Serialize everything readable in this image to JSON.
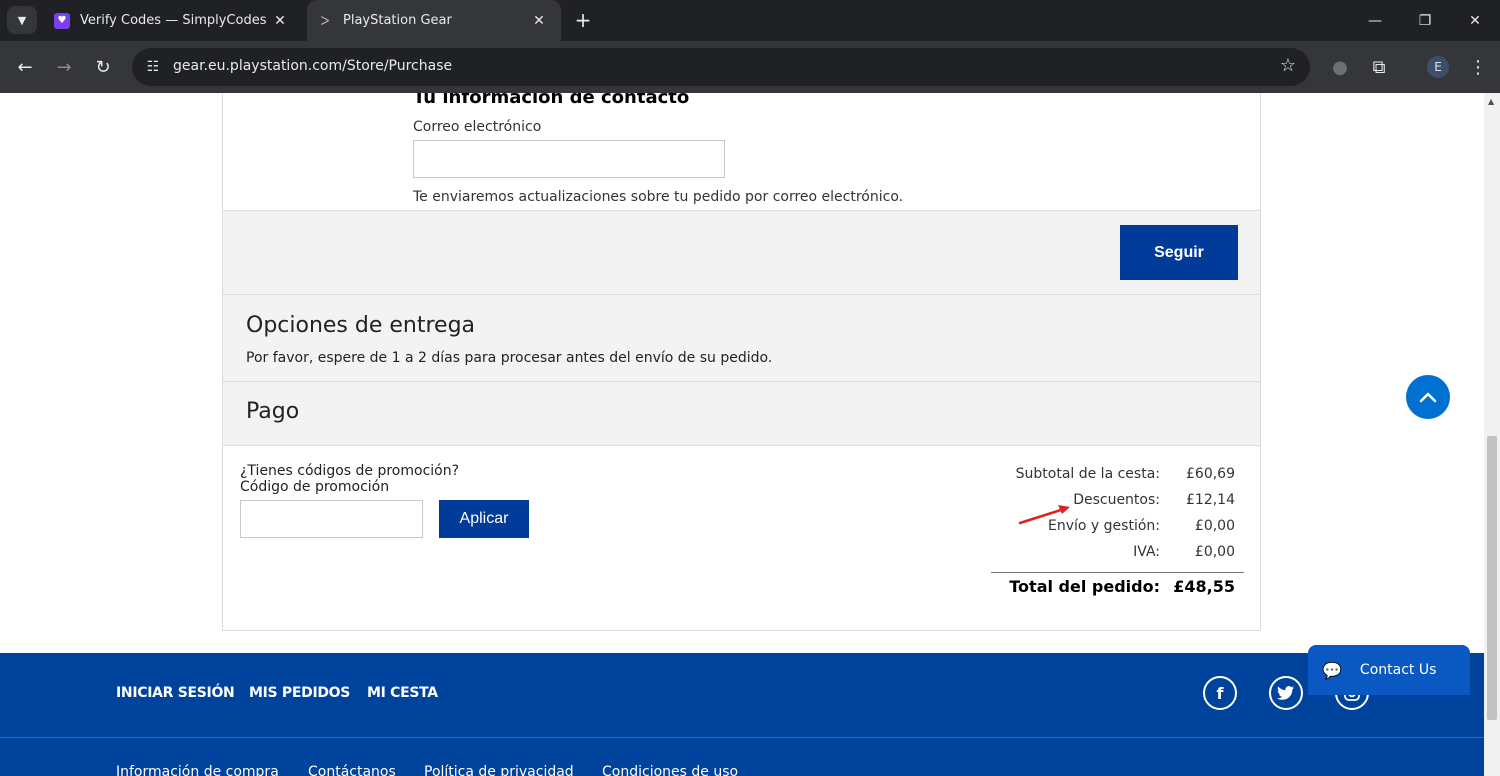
{
  "browser": {
    "tabs": [
      {
        "title": "Verify Codes — SimplyCodes",
        "active": false
      },
      {
        "title": "PlayStation Gear",
        "active": true
      }
    ],
    "url": "gear.eu.playstation.com/Store/Purchase",
    "profile_initial": "E"
  },
  "contact": {
    "title": "Tu información de contacto",
    "email_label": "Correo electrónico",
    "email_value": "",
    "note": "Te enviaremos actualizaciones sobre tu pedido por correo electrónico.",
    "continue_label": "Seguir"
  },
  "delivery": {
    "title": "Opciones de entrega",
    "note": "Por favor, espere de 1 a 2 días para procesar antes del envío de su pedido."
  },
  "payment": {
    "title": "Pago",
    "promo_question": "¿Tienes códigos de promoción?",
    "promo_label": "Código de promoción",
    "promo_value": "",
    "apply_label": "Aplicar"
  },
  "summary": {
    "rows": [
      {
        "label": "Subtotal de la cesta:",
        "value": "£60,69"
      },
      {
        "label": "Descuentos:",
        "value": "£12,14"
      },
      {
        "label": "Envío y gestión:",
        "value": "£0,00"
      },
      {
        "label": "IVA:",
        "value": "£0,00"
      }
    ],
    "total_label": "Total del pedido:",
    "total_value": "£48,55"
  },
  "footer": {
    "nav": [
      "INICIAR SESIÓN",
      "MIS PEDIDOS",
      "MI CESTA"
    ],
    "links": [
      "Información de compra",
      "Contáctanos",
      "Política de privacidad",
      "Condiciones de uso"
    ],
    "social_icons": [
      "facebook-icon",
      "twitter-icon",
      "instagram-icon"
    ]
  },
  "widgets": {
    "contact_us_label": "Contact Us"
  },
  "colors": {
    "brand_blue": "#003b9a",
    "footer_blue": "#00439c",
    "scroll_top_blue": "#0070d1",
    "annotation_red": "#e02020"
  }
}
